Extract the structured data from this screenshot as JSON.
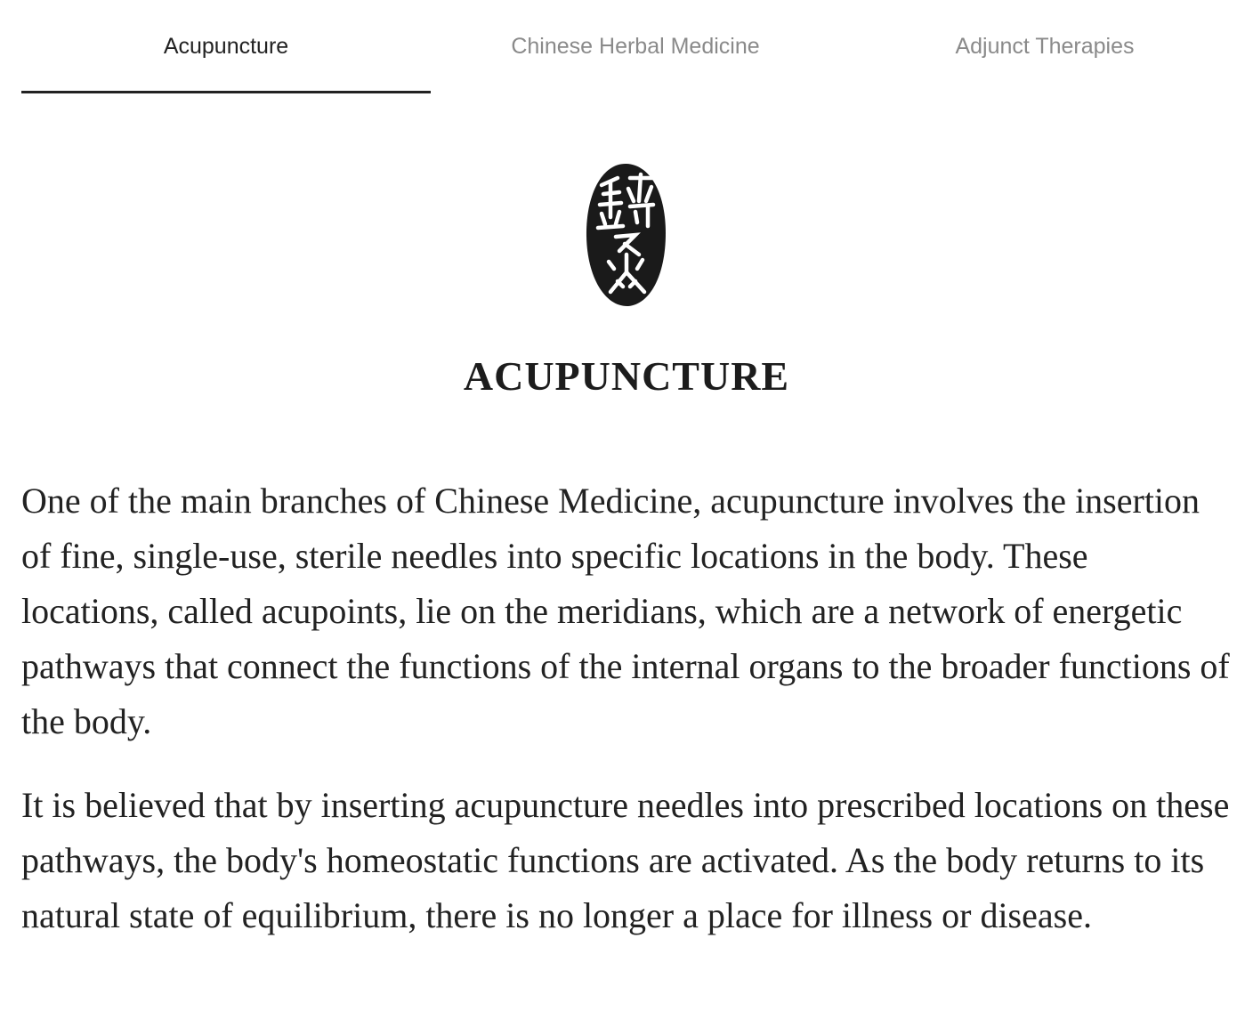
{
  "tabs": [
    {
      "label": "Acupuncture",
      "active": true
    },
    {
      "label": "Chinese Herbal Medicine",
      "active": false
    },
    {
      "label": "Adjunct Therapies",
      "active": false
    }
  ],
  "seal": {
    "icon": "acupuncture-seal-icon",
    "lettering": "鍼灸",
    "color": "#1a1a1a"
  },
  "section": {
    "title": "ACUPUNCTURE",
    "paragraphs": [
      "One of the main branches of Chinese Medicine, acupuncture involves the insertion of fine, single-use, sterile needles into specific locations in the body. These locations, called acupoints, lie on the meridians, which are a network of energetic pathways that connect the functions of the internal organs to the broader functions of the body.",
      "It is believed that by inserting acupuncture needles into prescribed locations on these pathways, the body's homeostatic functions are activated. As the body returns to its natural state of equilibrium, there is no longer a place for illness or disease."
    ]
  },
  "colors": {
    "active_tab": "#222222",
    "inactive_tab": "#8a8a8a",
    "text": "#222222"
  }
}
